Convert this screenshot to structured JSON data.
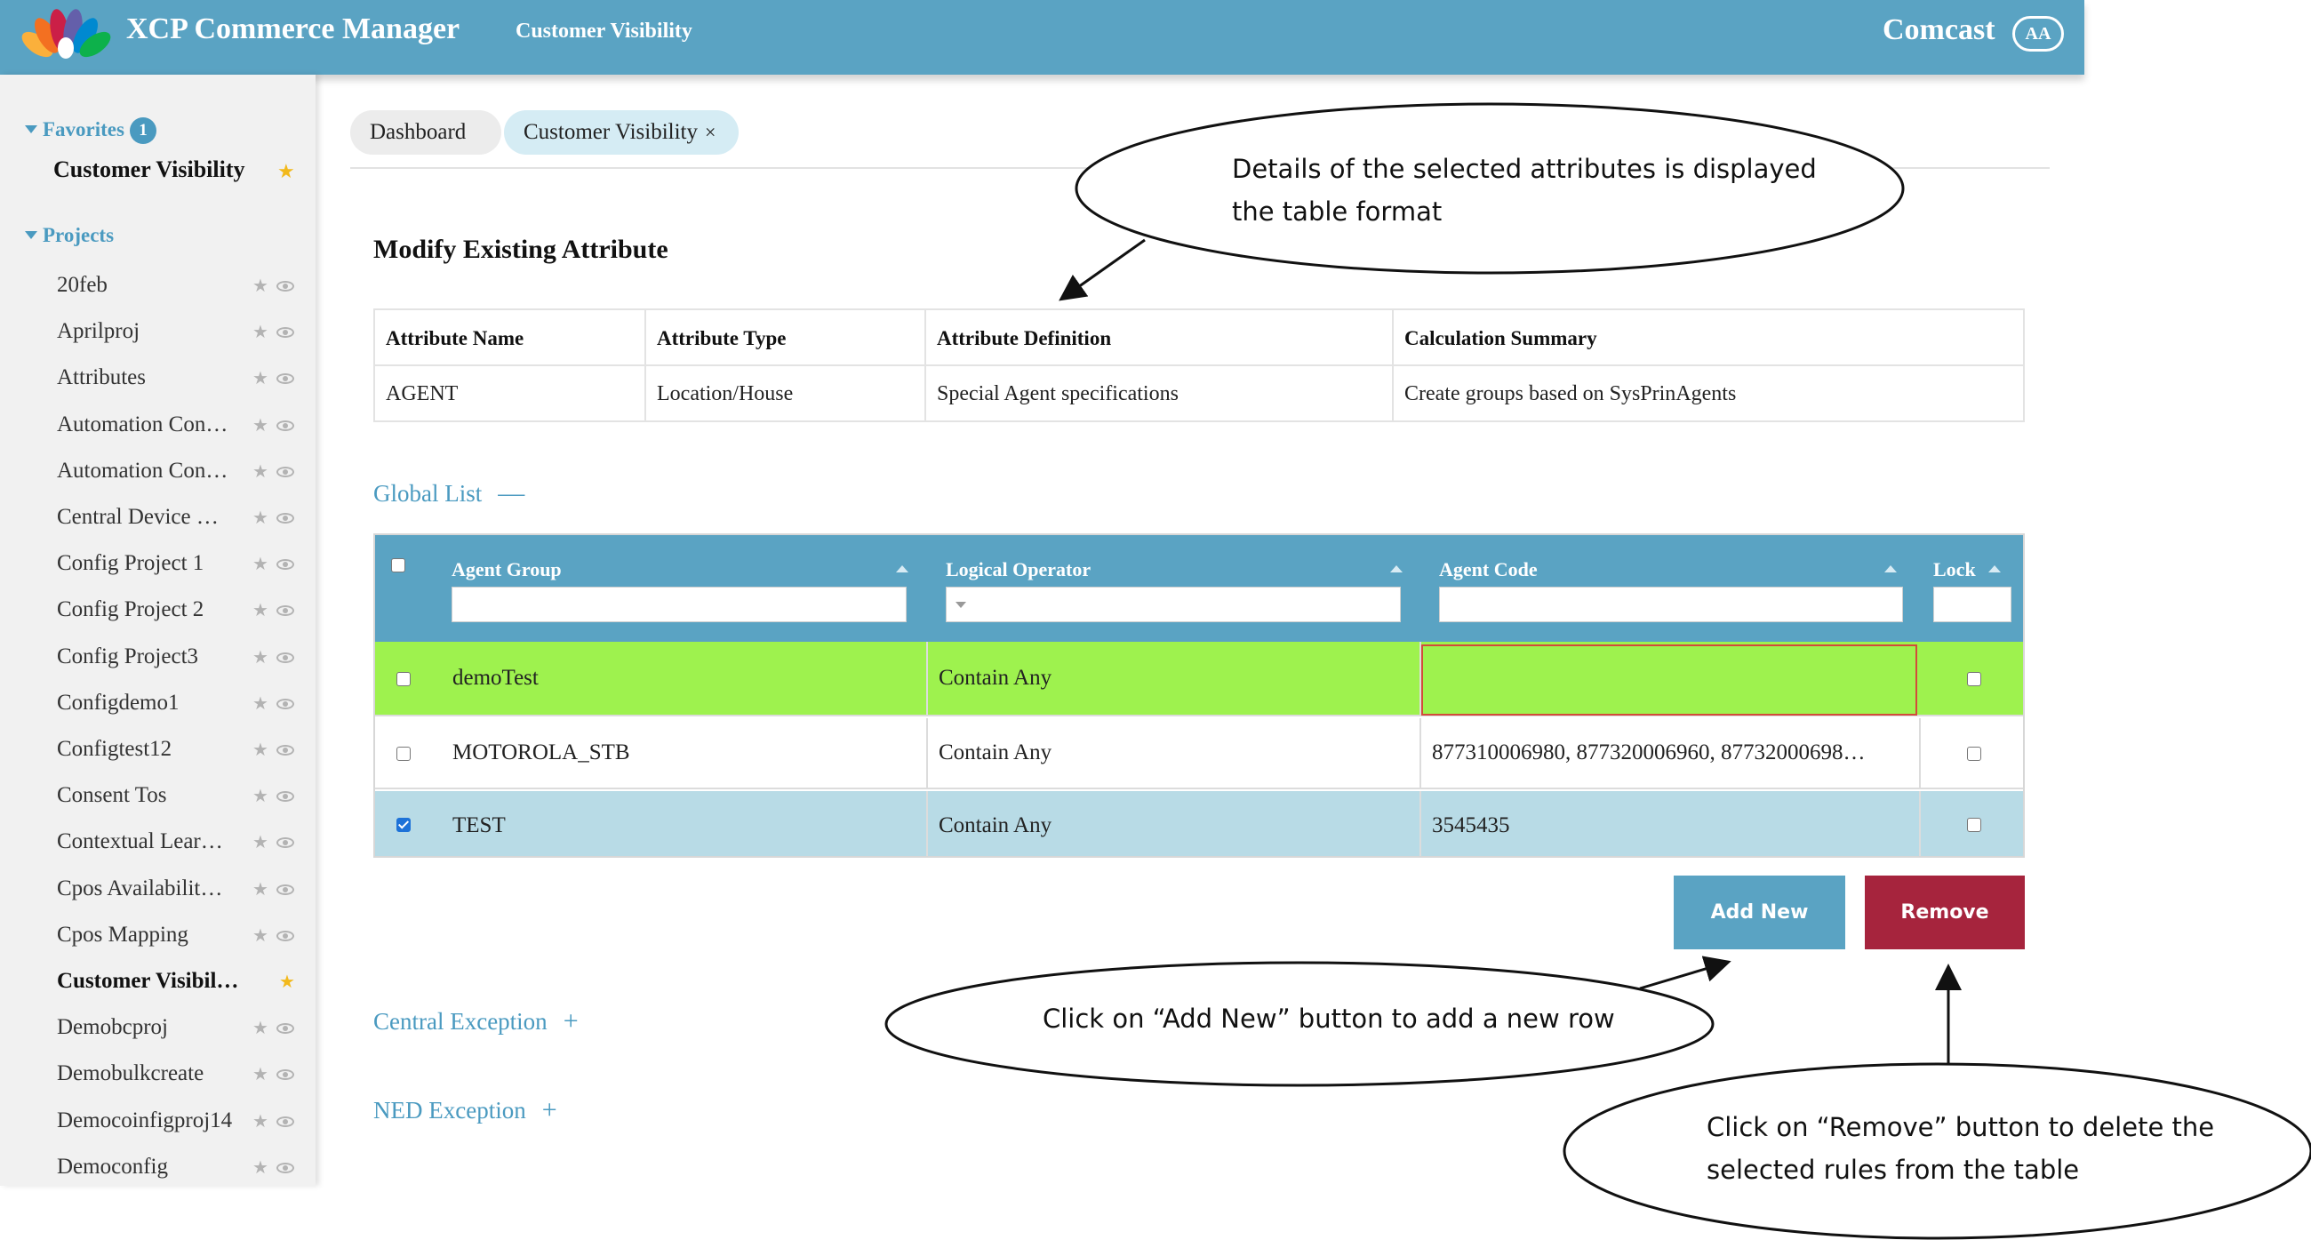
{
  "header": {
    "app_title": "XCP Commerce Manager",
    "breadcrumb": "Customer Visibility",
    "brand": "Comcast",
    "avatar_initials": "AA",
    "logo_colors": [
      "#fbb03b",
      "#f37021",
      "#cb1f47",
      "#645faa",
      "#0089d0",
      "#0db14b"
    ]
  },
  "sidebar": {
    "favorites_label": "Favorites",
    "favorites_count": "1",
    "favorite_item": "Customer Visibility",
    "projects_label": "Projects",
    "projects": [
      "20feb",
      "Aprilproj",
      "Attributes",
      "Automation Con…",
      "Automation Con…",
      "Central Device …",
      "Config Project 1",
      "Config Project 2",
      "Config Project3",
      "Configdemo1",
      "Configtest12",
      "Consent Tos",
      "Contextual Lear…",
      "Cpos Availabilit…",
      "Cpos Mapping",
      "Customer Visibility",
      "Demobcproj",
      "Demobulkcreate",
      "Democoinfigproj14",
      "Democonfig"
    ],
    "active_project": "Customer Visibility"
  },
  "tabs": {
    "dashboard": "Dashboard",
    "customer_visibility": "Customer Visibility",
    "close_glyph": "×"
  },
  "main": {
    "title": "Modify Existing Attribute",
    "attribute_table": {
      "headers": [
        "Attribute Name",
        "Attribute Type",
        "Attribute Definition",
        "Calculation Summary"
      ],
      "row": [
        "AGENT",
        "Location/House",
        "Special Agent specifications",
        "Create groups based on SysPrinAgents"
      ]
    },
    "global_list": {
      "label": "Global List",
      "toggle": "—",
      "columns": [
        "Agent Group",
        "Logical Operator",
        "Agent Code",
        "Lock"
      ],
      "rows": [
        {
          "agent_group": "demoTest",
          "logical_operator": "Contain Any",
          "agent_code": "",
          "checked": false,
          "lock": false,
          "row_color": "#9ef24e"
        },
        {
          "agent_group": "MOTOROLA_STB",
          "logical_operator": "Contain Any",
          "agent_code": "877310006980, 877320006960, 87732000698…",
          "checked": false,
          "lock": false,
          "row_color": "#ffffff"
        },
        {
          "agent_group": "TEST",
          "logical_operator": "Contain Any",
          "agent_code": "3545435",
          "checked": true,
          "lock": false,
          "row_color": "#b8dbe6"
        }
      ]
    },
    "buttons": {
      "add_new": "Add New",
      "remove": "Remove"
    },
    "central_exception": {
      "label": "Central Exception",
      "toggle": "+"
    },
    "ned_exception": {
      "label": "NED Exception",
      "toggle": "+"
    }
  },
  "annotations": {
    "details_line1": "Details of the selected attributes is displayed",
    "details_line2": "the table format",
    "add_new_note": "Click on “Add New” button to add a new row",
    "remove_line1": "Click on “Remove” button to delete the",
    "remove_line2": "selected rules from the table"
  },
  "colors": {
    "header_bg": "#5aa3c3",
    "accent": "#4a9ac0",
    "remove_button": "#a6243d",
    "star_active": "#f2b91c"
  }
}
